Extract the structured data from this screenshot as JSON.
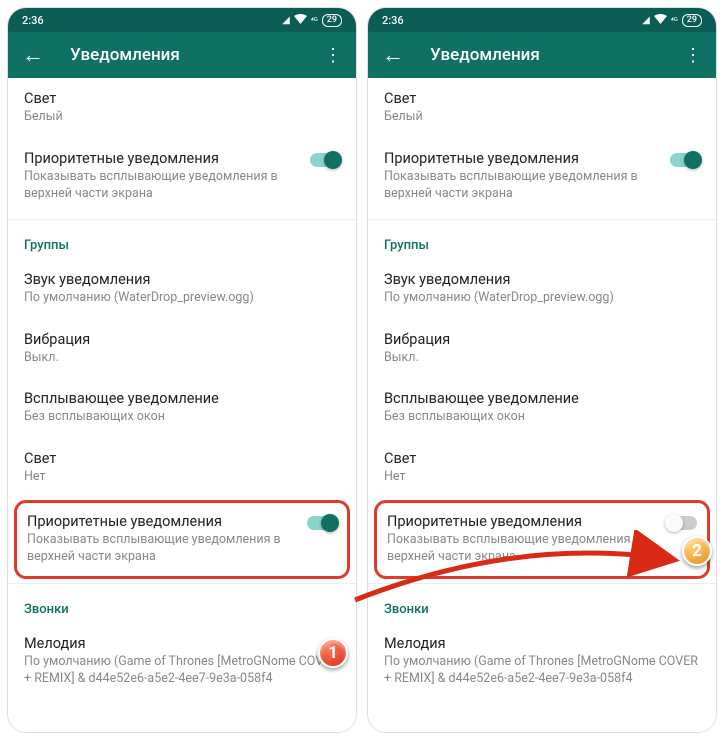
{
  "statusbar": {
    "time": "2:36",
    "battery": "29"
  },
  "header": {
    "title": "Уведомления"
  },
  "row_light": {
    "title": "Свет",
    "sub": "Белый"
  },
  "row_priority_top": {
    "title": "Приоритетные уведомления",
    "sub": "Показывать всплывающие уведомления в верхней части экрана"
  },
  "section_groups": "Группы",
  "row_sound": {
    "title": "Звук уведомления",
    "sub": "По умолчанию (WaterDrop_preview.ogg)"
  },
  "row_vibration": {
    "title": "Вибрация",
    "sub": "Выкл."
  },
  "row_popup": {
    "title": "Всплывающее уведомление",
    "sub": "Без всплывающих окон"
  },
  "row_light2": {
    "title": "Свет",
    "sub": "Нет"
  },
  "row_priority_box": {
    "title": "Приоритетные уведомления",
    "sub": "Показывать всплывающие уведомления в верхней части экрана"
  },
  "section_calls": "Звонки",
  "row_melody": {
    "title": "Мелодия",
    "sub": "По умолчанию (Game of Thrones [MetroGNome COVER + REMIX] & d44e52e6-a5e2-4ee7-9e3a-058f4"
  },
  "badge1": "1",
  "badge2": "2"
}
